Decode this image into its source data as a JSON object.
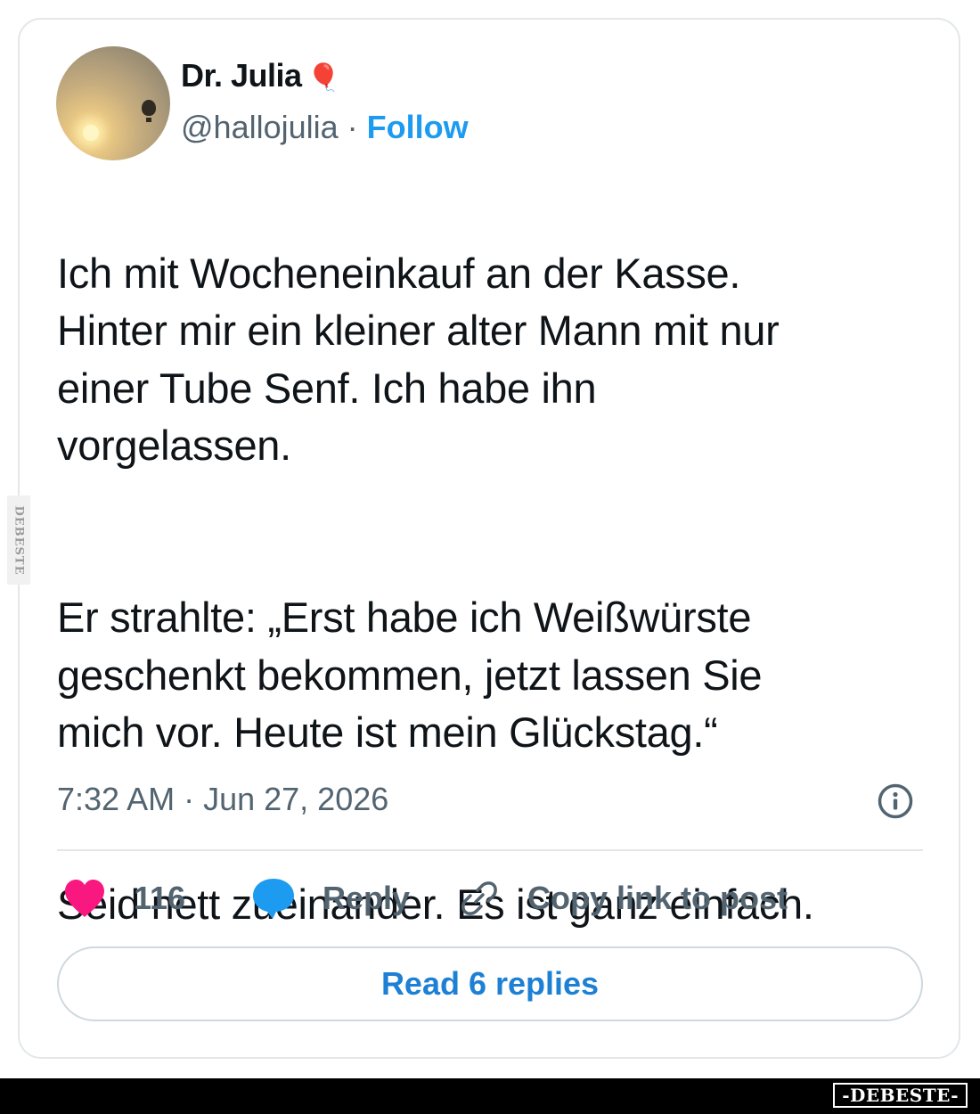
{
  "author": {
    "name": "Dr. Julia",
    "name_emoji": "🎈",
    "handle": "@hallojulia",
    "separator": " · ",
    "follow_label": "Follow"
  },
  "tweet": {
    "paragraphs": [
      "Ich mit Wocheneinkauf an der Kasse.\nHinter mir ein kleiner alter Mann mit nur\neiner Tube Senf. Ich habe ihn\nvorgelassen.",
      "Er strahlte: „Erst habe ich Weißwürste\ngeschenkt bekommen, jetzt lassen Sie\nmich vor. Heute ist mein Glückstag.“",
      "Seid nett zueinander. Es ist ganz einfach."
    ],
    "timestamp": "7:32 AM · Jun 27, 2026"
  },
  "actions": {
    "like_count": "116",
    "reply_label": "Reply",
    "copy_link_label": "Copy link to post",
    "read_replies_label": "Read 6 replies"
  },
  "icons": {
    "heart": "heart-icon",
    "reply": "speech-bubble-icon",
    "copy_link": "link-icon",
    "info": "info-icon"
  },
  "colors": {
    "heart": "#f91880",
    "reply_bubble": "#1d9bf0",
    "follow": "#1d9bf0",
    "read_replies": "#1d80d4",
    "text": "#0f1419",
    "secondary_text": "#536471"
  },
  "watermark": {
    "side": "DEBESTE",
    "bottom": "-DEBESTE-"
  }
}
